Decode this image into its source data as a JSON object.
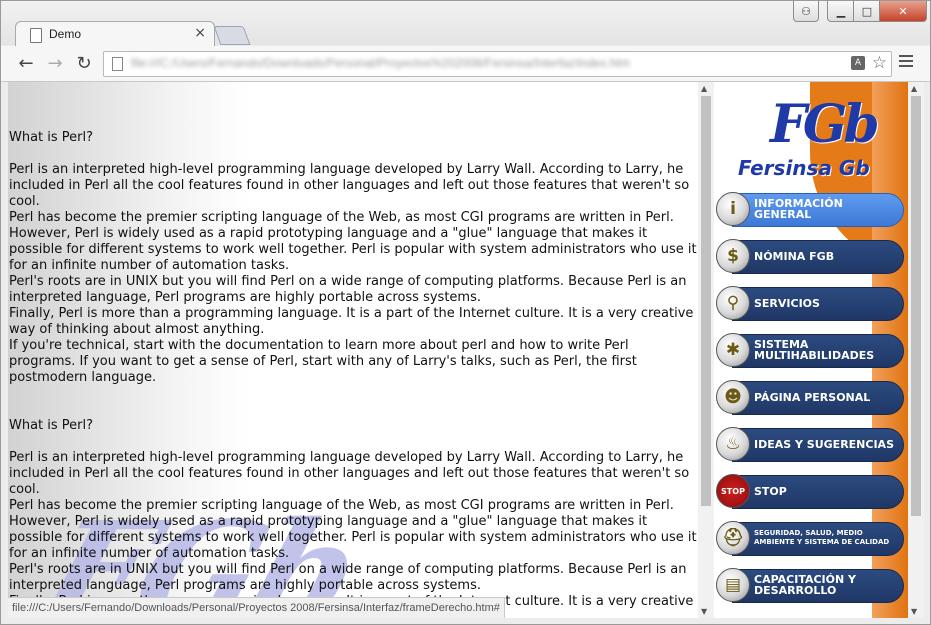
{
  "browser": {
    "tab_title": "Demo",
    "tab_close": "×",
    "url": "file:///C:/Users/Fernando/Downloads/Personal/Proyectos%202008/Fersinsa/Interfaz/index.htm",
    "translate_glyph": "A",
    "star_glyph": "☆",
    "back_glyph": "←",
    "forward_glyph": "→",
    "reload_glyph": "↻",
    "win_minimize": "▁",
    "win_maximize": "□",
    "win_close": "✕",
    "user_glyph": "👤"
  },
  "article": {
    "heading": "What is Perl?",
    "paragraphs": [
      "Perl is an interpreted high-level programming language developed by Larry Wall. According to Larry, he included in Perl all the cool features found in other languages and left out those features that weren't so cool.",
      "Perl has become the premier scripting language of the Web, as most CGI programs are written in Perl. However, Perl is widely used as a rapid prototyping language and a \"glue\" language that makes it possible for different systems to work well together. Perl is popular with system administrators who use it for an infinite number of automation tasks.",
      "Perl's roots are in UNIX but you will find Perl on a wide range of computing platforms. Because Perl is an interpreted language, Perl programs are highly portable across systems.",
      "Finally, Perl is more than a programming language. It is a part of the Internet culture. It is a very creative way of thinking about almost anything.",
      "If you're technical, start with the documentation to learn more about perl and how to write Perl programs. If you want to get a sense of Perl, start with any of Larry's talks, such as Perl, the first postmodern language."
    ]
  },
  "status_url": "file:///C:/Users/Fernando/Downloads/Personal/Proyectos 2008/Fersinsa/Interfaz/frameDerecho.htm#",
  "sidebar": {
    "logo_mark": "FGb",
    "logo_text": "Fersinsa Gb",
    "items": [
      {
        "label": "INFORMACIÓN GENERAL",
        "icon": "info-person-icon",
        "glyph": "i",
        "active": true
      },
      {
        "label": "NÓMINA FGB",
        "icon": "dollar-icon",
        "glyph": "$",
        "active": false
      },
      {
        "label": "SERVICIOS",
        "icon": "wrench-icon",
        "glyph": "⚲",
        "active": false
      },
      {
        "label": "SISTEMA MULTIHABILIDADES",
        "icon": "spider-icon",
        "glyph": "✱",
        "active": false
      },
      {
        "label": "PÁGINA PERSONAL",
        "icon": "smiley-icon",
        "glyph": "☻",
        "active": false
      },
      {
        "label": "IDEAS Y SUGERENCIAS",
        "icon": "lightbulb-icon",
        "glyph": "♨",
        "active": false
      },
      {
        "label": "STOP",
        "icon": "stop-sign-icon",
        "glyph": "STOP",
        "active": false
      },
      {
        "label": "SEGURIDAD, SALUD, MEDIO AMBIENTE Y SISTEMA DE CALIDAD",
        "icon": "hardhat-icon",
        "glyph": "⛑",
        "active": false
      },
      {
        "label": "CAPACITACIÓN Y DESARROLLO",
        "icon": "book-icon",
        "glyph": "▤",
        "active": false
      }
    ]
  }
}
